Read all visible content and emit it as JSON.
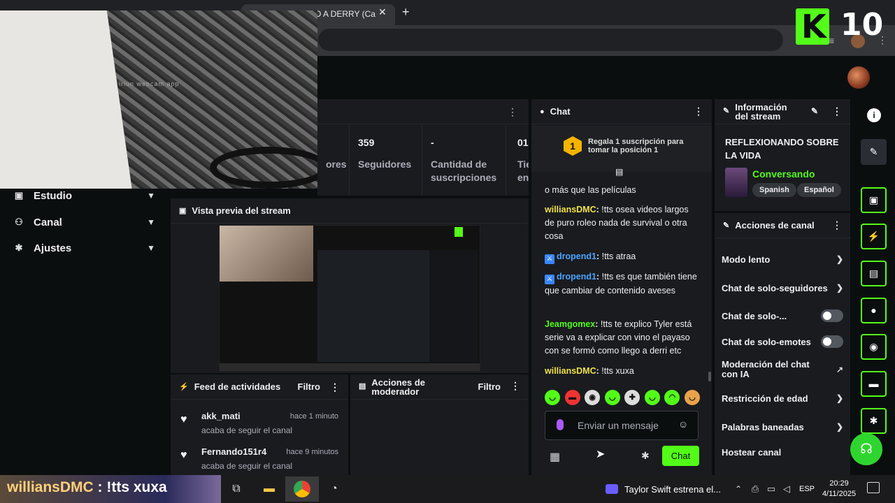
{
  "browser": {
    "tab_title": "O A DERRY (Ca",
    "tab_close": "✕",
    "new_tab": "+"
  },
  "overlay": {
    "webcam_watermark": "iriun webcam app",
    "kick_count": "10"
  },
  "nav": {
    "items": [
      {
        "label": "Estudio"
      },
      {
        "label": "Canal"
      },
      {
        "label": "Ajustes"
      }
    ]
  },
  "stats": {
    "items": [
      {
        "value": "",
        "label": "ores"
      },
      {
        "value": "359",
        "label": "Seguidores"
      },
      {
        "value": "-",
        "label": "Cantidad de suscripciones"
      },
      {
        "value": "01",
        "label": "Tie en"
      }
    ]
  },
  "preview": {
    "title": "Vista previa del stream"
  },
  "feed": {
    "title": "Feed de actividades",
    "filter": "Filtro",
    "items": [
      {
        "user": "akk_mati",
        "time": "hace 1 minuto",
        "action": "acaba de seguir el canal"
      },
      {
        "user": "Fernando151r4",
        "time": "hace 9 minutos",
        "action": "acaba de seguir el canal"
      }
    ]
  },
  "moderator": {
    "title": "Acciones de moderador",
    "filter": "Filtro"
  },
  "chat": {
    "title": "Chat",
    "sub_banner": "Regala 1 suscripción para tomar la posición 1",
    "sub_badge_number": "1",
    "messages": [
      {
        "user": "",
        "text": "o más que las películas",
        "color": "blue"
      },
      {
        "user": "williansDMC",
        "text": "!tts osea videos largos de puro roleo nada de survival o otra cosa",
        "color": "yellow"
      },
      {
        "user": "dropend1",
        "text": "!tts atraa",
        "color": "blue"
      },
      {
        "user": "dropend1",
        "text": "!tts es que también tiene que cambiar de contenido aveses",
        "color": "blue"
      },
      {
        "user": "Jeamgomex",
        "text": "!tts te explico Tyler está serie va a explicar con vino el payaso con se formó como llego a derri etc",
        "color": "green"
      },
      {
        "user": "williansDMC",
        "text": "!tts xuxa",
        "color": "yellow"
      }
    ],
    "input_placeholder": "Enviar un mensaje",
    "send_label": "Chat"
  },
  "stream_info": {
    "title": "Información del stream",
    "stream_title": "REFLEXIONANDO SOBRE LA VIDA",
    "category": "Conversando",
    "tags": [
      "Spanish",
      "Español"
    ]
  },
  "channel_actions": {
    "title": "Acciones de canal",
    "items": [
      {
        "label": "Modo lento",
        "kind": "chevron"
      },
      {
        "label": "Chat de solo-seguidores",
        "kind": "chevron"
      },
      {
        "label": "Chat de solo-...",
        "kind": "toggle"
      },
      {
        "label": "Chat de solo-emotes",
        "kind": "toggle"
      },
      {
        "label": "Moderación del chat con IA",
        "kind": "external"
      },
      {
        "label": "Restricción de edad",
        "kind": "chevron"
      },
      {
        "label": "Palabras baneadas",
        "kind": "chevron"
      },
      {
        "label": "Hostear canal",
        "kind": "none"
      }
    ]
  },
  "taskbar": {
    "ticker_user": "williansDMC",
    "ticker_text": " : !tts xuxa",
    "news": "Taylor Swift estrena el...",
    "lang": "ESP",
    "time": "20:29",
    "date": "4/11/2025"
  },
  "colors": {
    "accent": "#53fc18",
    "background": "#0b0e0f",
    "panel": "#191b1f"
  }
}
